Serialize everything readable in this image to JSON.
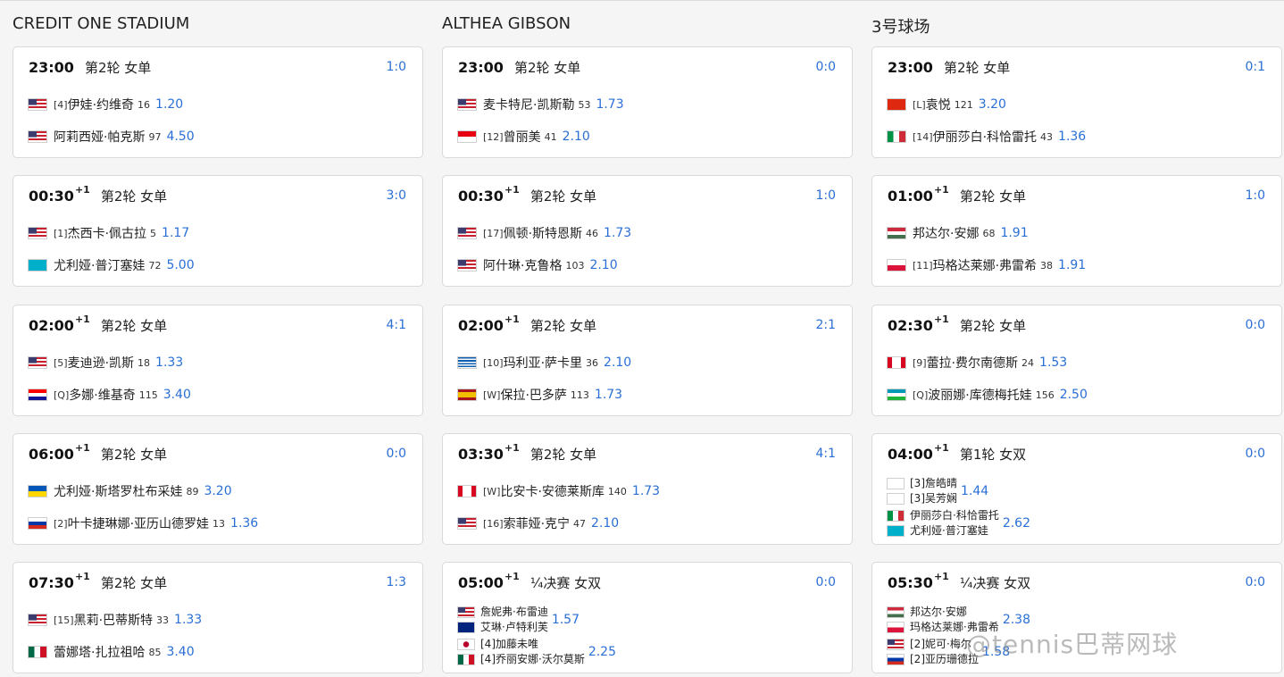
{
  "columns": [
    {
      "title": "CREDIT ONE STADIUM",
      "matches": [
        {
          "time": "23:00",
          "day_plus": "",
          "round": "第2轮 女单",
          "score": "1:0",
          "players": [
            {
              "flag": "us",
              "seed": "[4]",
              "name": "伊娃·约维奇",
              "rank": "16",
              "odds": "1.20"
            },
            {
              "flag": "us",
              "seed": "",
              "name": "阿莉西娅·帕克斯",
              "rank": "97",
              "odds": "4.50"
            }
          ]
        },
        {
          "time": "00:30",
          "day_plus": "+1",
          "round": "第2轮 女单",
          "score": "3:0",
          "players": [
            {
              "flag": "us",
              "seed": "[1]",
              "name": "杰西卡·佩古拉",
              "rank": "5",
              "odds": "1.17"
            },
            {
              "flag": "kz",
              "seed": "",
              "name": "尤利娅·普汀塞娃",
              "rank": "72",
              "odds": "5.00"
            }
          ]
        },
        {
          "time": "02:00",
          "day_plus": "+1",
          "round": "第2轮 女单",
          "score": "4:1",
          "players": [
            {
              "flag": "us",
              "seed": "[5]",
              "name": "麦迪逊·凯斯",
              "rank": "18",
              "odds": "1.33"
            },
            {
              "flag": "hr",
              "seed": "[Q]",
              "name": "多娜·维基奇",
              "rank": "115",
              "odds": "3.40"
            }
          ]
        },
        {
          "time": "06:00",
          "day_plus": "+1",
          "round": "第2轮 女单",
          "score": "0:0",
          "players": [
            {
              "flag": "ua",
              "seed": "",
              "name": "尤利娅·斯塔罗杜布采娃",
              "rank": "89",
              "odds": "3.20"
            },
            {
              "flag": "ru",
              "seed": "[2]",
              "name": "叶卡捷琳娜·亚历山德罗娃",
              "rank": "13",
              "odds": "1.36"
            }
          ]
        },
        {
          "time": "07:30",
          "day_plus": "+1",
          "round": "第2轮 女单",
          "score": "1:3",
          "players": [
            {
              "flag": "us",
              "seed": "[15]",
              "name": "黑莉·巴蒂斯特",
              "rank": "33",
              "odds": "1.33"
            },
            {
              "flag": "mx",
              "seed": "",
              "name": "蕾娜塔·扎拉祖哈",
              "rank": "85",
              "odds": "3.40"
            }
          ]
        }
      ]
    },
    {
      "title": "ALTHEA GIBSON",
      "matches": [
        {
          "time": "23:00",
          "day_plus": "",
          "round": "第2轮 女单",
          "score": "0:0",
          "players": [
            {
              "flag": "us",
              "seed": "",
              "name": "麦卡特尼·凯斯勒",
              "rank": "53",
              "odds": "1.73"
            },
            {
              "flag": "id",
              "seed": "[12]",
              "name": "曾丽美",
              "rank": "41",
              "odds": "2.10"
            }
          ]
        },
        {
          "time": "00:30",
          "day_plus": "+1",
          "round": "第2轮 女单",
          "score": "1:0",
          "players": [
            {
              "flag": "us",
              "seed": "[17]",
              "name": "佩顿·斯特恩斯",
              "rank": "46",
              "odds": "1.73"
            },
            {
              "flag": "us",
              "seed": "",
              "name": "阿什琳·克鲁格",
              "rank": "103",
              "odds": "2.10"
            }
          ]
        },
        {
          "time": "02:00",
          "day_plus": "+1",
          "round": "第2轮 女单",
          "score": "2:1",
          "players": [
            {
              "flag": "gr",
              "seed": "[10]",
              "name": "玛利亚·萨卡里",
              "rank": "36",
              "odds": "2.10"
            },
            {
              "flag": "es",
              "seed": "[W]",
              "name": "保拉·巴多萨",
              "rank": "113",
              "odds": "1.73"
            }
          ]
        },
        {
          "time": "03:30",
          "day_plus": "+1",
          "round": "第2轮 女单",
          "score": "4:1",
          "players": [
            {
              "flag": "ca",
              "seed": "[W]",
              "name": "比安卡·安德莱斯库",
              "rank": "140",
              "odds": "1.73"
            },
            {
              "flag": "us",
              "seed": "[16]",
              "name": "索菲娅·克宁",
              "rank": "47",
              "odds": "2.10"
            }
          ]
        },
        {
          "time": "05:00",
          "day_plus": "+1",
          "round": "¼决赛 女双",
          "score": "0:0",
          "teams": [
            {
              "flags": [
                "us",
                "au"
              ],
              "seed": "",
              "names": [
                "詹妮弗·布雷迪",
                "艾琳·卢特利芙"
              ],
              "odds": "1.57"
            },
            {
              "flags": [
                "jp",
                "mx"
              ],
              "seed": "[4]",
              "names": [
                "[4]加藤未唯",
                "[4]乔丽安娜·沃尔莫斯"
              ],
              "odds": "2.25"
            }
          ]
        }
      ]
    },
    {
      "title": "3号球场",
      "matches": [
        {
          "time": "23:00",
          "day_plus": "",
          "round": "第2轮 女单",
          "score": "0:1",
          "players": [
            {
              "flag": "cn",
              "seed": "[L]",
              "name": "袁悦",
              "rank": "121",
              "odds": "3.20"
            },
            {
              "flag": "it",
              "seed": "[14]",
              "name": "伊丽莎白·科恰雷托",
              "rank": "43",
              "odds": "1.36"
            }
          ]
        },
        {
          "time": "01:00",
          "day_plus": "+1",
          "round": "第2轮 女单",
          "score": "1:0",
          "players": [
            {
              "flag": "hu",
              "seed": "",
              "name": "邦达尔·安娜",
              "rank": "68",
              "odds": "1.91"
            },
            {
              "flag": "pl",
              "seed": "[11]",
              "name": "玛格达莱娜·弗雷希",
              "rank": "38",
              "odds": "1.91"
            }
          ]
        },
        {
          "time": "02:30",
          "day_plus": "+1",
          "round": "第2轮 女单",
          "score": "0:0",
          "players": [
            {
              "flag": "ca",
              "seed": "[9]",
              "name": "蕾拉·费尔南德斯",
              "rank": "24",
              "odds": "1.53"
            },
            {
              "flag": "uz",
              "seed": "[Q]",
              "name": "波丽娜·库德梅托娃",
              "rank": "156",
              "odds": "2.50"
            }
          ]
        },
        {
          "time": "04:00",
          "day_plus": "+1",
          "round": "第1轮 女双",
          "score": "0:0",
          "teams": [
            {
              "flags": [
                "tw",
                "tw"
              ],
              "seed": "[3]",
              "names": [
                "[3]詹皓晴",
                "[3]吴芳娴"
              ],
              "odds": "1.44"
            },
            {
              "flags": [
                "it",
                "kz"
              ],
              "seed": "",
              "names": [
                "伊丽莎白·科恰雷托",
                "尤利娅·普汀塞娃"
              ],
              "odds": "2.62"
            }
          ]
        },
        {
          "time": "05:30",
          "day_plus": "+1",
          "round": "¼决赛 女双",
          "score": "0:0",
          "teams": [
            {
              "flags": [
                "hu",
                "pl"
              ],
              "seed": "",
              "names": [
                "邦达尔·安娜",
                "玛格达莱娜·弗雷希"
              ],
              "odds": "2.38"
            },
            {
              "flags": [
                "us",
                "ru"
              ],
              "seed": "[2]",
              "names": [
                "[2]妮可·梅尔",
                "[2]亚历珊德拉"
              ],
              "odds": "1.58"
            }
          ]
        }
      ]
    }
  ],
  "watermark": "@tennis巴蒂网球"
}
